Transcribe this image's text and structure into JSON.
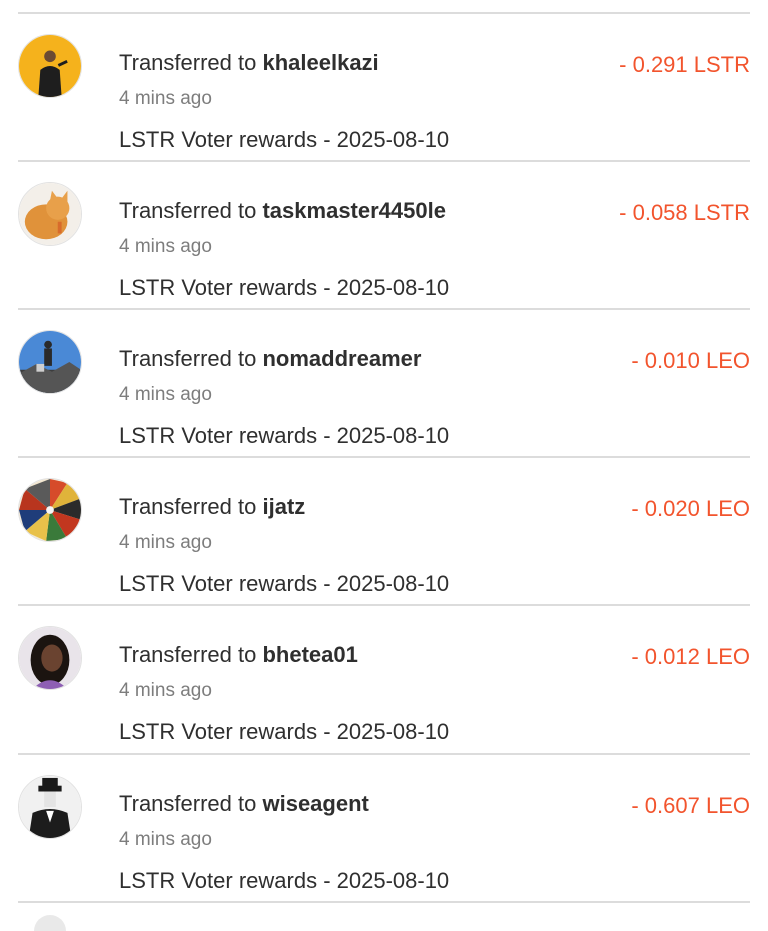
{
  "colors": {
    "amount": "#f2542d",
    "text": "#2f2f2f",
    "muted": "#7d7d7d",
    "divider": "#dcdcdc"
  },
  "transactions": [
    {
      "prefix": "Transferred to",
      "user": "khaleelkazi",
      "time": "4 mins ago",
      "memo": "LSTR Voter rewards - 2025-08-10",
      "amount": "- 0.291 LSTR",
      "avatar_icon": "speaker-on-stage-avatar"
    },
    {
      "prefix": "Transferred to",
      "user": "taskmaster4450le",
      "time": "4 mins ago",
      "memo": "LSTR Voter rewards - 2025-08-10",
      "amount": "- 0.058 LSTR",
      "avatar_icon": "orange-cat-avatar"
    },
    {
      "prefix": "Transferred to",
      "user": "nomaddreamer",
      "time": "4 mins ago",
      "memo": "LSTR Voter rewards - 2025-08-10",
      "amount": "- 0.010 LEO",
      "avatar_icon": "hiker-on-rock-avatar"
    },
    {
      "prefix": "Transferred to",
      "user": "ijatz",
      "time": "4 mins ago",
      "memo": "LSTR Voter rewards - 2025-08-10",
      "amount": "- 0.020 LEO",
      "avatar_icon": "colorful-radial-avatar"
    },
    {
      "prefix": "Transferred to",
      "user": "bhetea01",
      "time": "4 mins ago",
      "memo": "LSTR Voter rewards - 2025-08-10",
      "amount": "- 0.012 LEO",
      "avatar_icon": "woman-portrait-avatar"
    },
    {
      "prefix": "Transferred to",
      "user": "wiseagent",
      "time": "4 mins ago",
      "memo": "LSTR Voter rewards - 2025-08-10",
      "amount": "- 0.607 LEO",
      "avatar_icon": "suited-figure-avatar"
    }
  ]
}
